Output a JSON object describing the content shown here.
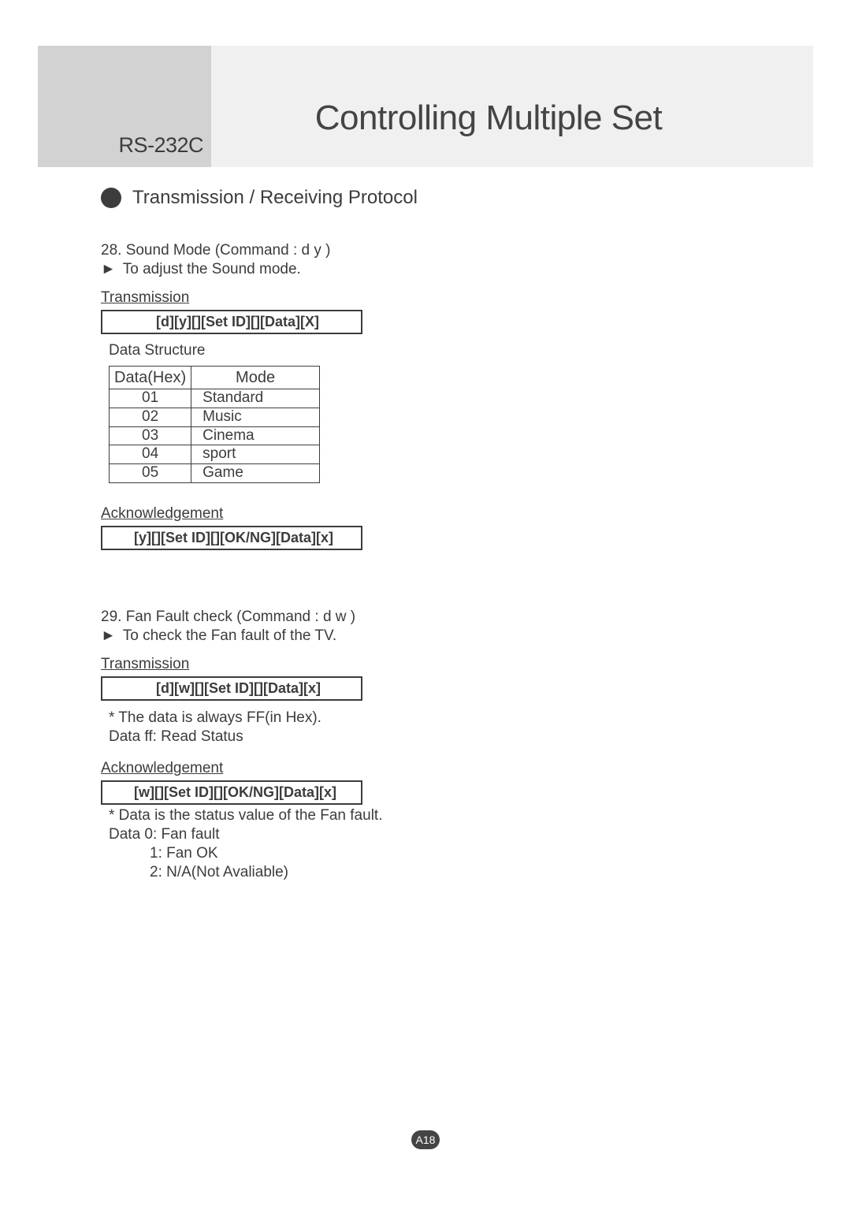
{
  "header": {
    "connector": "RS-232C",
    "title": "Controlling Multiple Set"
  },
  "section_heading": "Transmission / Receiving Protocol",
  "cmd28": {
    "title": "28. Sound Mode (Command : d y )",
    "desc": "To adjust the Sound mode.",
    "tx_label": "Transmission",
    "tx_frame": "[d][y][][Set ID][][Data][X]",
    "data_structure_label": "Data Structure",
    "table": {
      "head_hex": "Data(Hex)",
      "head_mode": "Mode",
      "rows": [
        {
          "hex": "01",
          "mode": "Standard"
        },
        {
          "hex": "02",
          "mode": "Music"
        },
        {
          "hex": "03",
          "mode": "Cinema"
        },
        {
          "hex": "04",
          "mode": "sport"
        },
        {
          "hex": "05",
          "mode": "Game"
        }
      ]
    },
    "ack_label": "Acknowledgement",
    "ack_frame": "[y][][Set ID][][OK/NG][Data][x]"
  },
  "cmd29": {
    "title": "29. Fan Fault check (Command : d w )",
    "desc": "To check the Fan fault of the TV.",
    "tx_label": "Transmission",
    "tx_frame": "[d][w][][Set ID][][Data][x]",
    "tx_note1": "* The data is always FF(in Hex).",
    "tx_note2": "Data ff: Read Status",
    "ack_label": "Acknowledgement",
    "ack_frame": "[w][][Set ID][][OK/NG][Data][x]",
    "ack_note1": "* Data is the status value of the Fan fault.",
    "ack_note2": "Data 0: Fan fault",
    "ack_note3": "1: Fan OK",
    "ack_note4": "2: N/A(Not Avaliable)"
  },
  "page_number": "A18"
}
